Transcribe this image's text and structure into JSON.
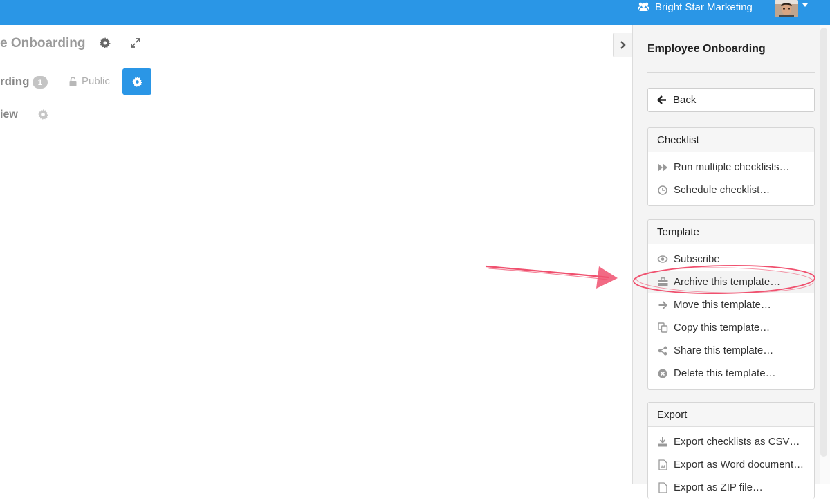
{
  "header": {
    "org_name": "Bright Star Marketing",
    "org_icon": "users-icon",
    "avatar_icon": "user-avatar",
    "dropdown_icon": "caret-down-icon",
    "accent_color": "#2a96e6"
  },
  "main": {
    "title": "e Onboarding",
    "subtitle": "rding",
    "count_badge": "1",
    "visibility": "Public",
    "view_label": "iew"
  },
  "panel": {
    "title": "Employee Onboarding",
    "back_label": "Back",
    "groups": [
      {
        "heading": "Checklist",
        "items": [
          {
            "label": "Run multiple checklists…",
            "icon": "fast-forward-icon"
          },
          {
            "label": "Schedule checklist…",
            "icon": "clock-icon"
          }
        ]
      },
      {
        "heading": "Template",
        "items": [
          {
            "label": "Subscribe",
            "icon": "eye-icon"
          },
          {
            "label": "Archive this template…",
            "icon": "briefcase-icon"
          },
          {
            "label": "Move this template…",
            "icon": "arrow-right-icon"
          },
          {
            "label": "Copy this template…",
            "icon": "copy-icon"
          },
          {
            "label": "Share this template…",
            "icon": "share-icon"
          },
          {
            "label": "Delete this template…",
            "icon": "delete-circle-icon"
          }
        ]
      },
      {
        "heading": "Export",
        "items": [
          {
            "label": "Export checklists as CSV…",
            "icon": "download-icon"
          },
          {
            "label": "Export as Word document…",
            "icon": "word-file-icon"
          },
          {
            "label": "Export as ZIP file…",
            "icon": "zip-file-icon"
          }
        ]
      }
    ]
  },
  "annotation": {
    "color": "#f0506e"
  }
}
